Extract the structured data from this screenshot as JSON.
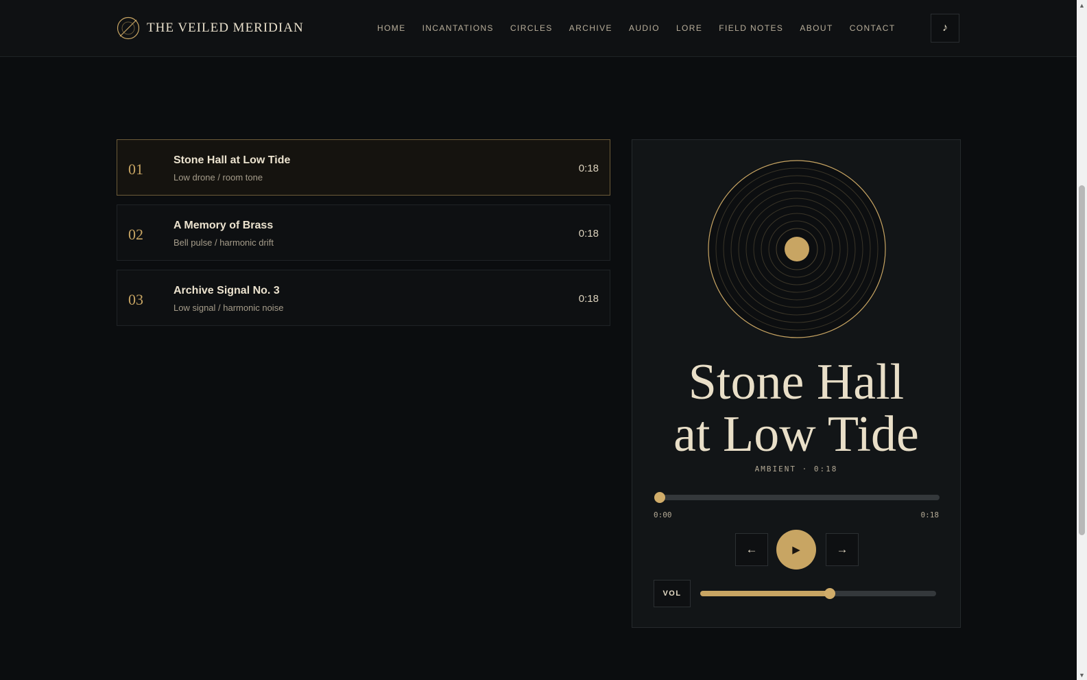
{
  "brand": {
    "name": "THE VEILED MERIDIAN"
  },
  "nav": [
    "HOME",
    "INCANTATIONS",
    "CIRCLES",
    "ARCHIVE",
    "AUDIO",
    "LORE",
    "FIELD NOTES",
    "ABOUT",
    "CONTACT"
  ],
  "header": {
    "music_icon": "♪"
  },
  "tracks": [
    {
      "num": "01",
      "title": "Stone Hall at Low Tide",
      "sub": "Low drone / room tone",
      "dur": "0:18"
    },
    {
      "num": "02",
      "title": "A Memory of Brass",
      "sub": "Bell pulse / harmonic drift",
      "dur": "0:18"
    },
    {
      "num": "03",
      "title": "Archive Signal No. 3",
      "sub": "Low signal / harmonic noise",
      "dur": "0:18"
    }
  ],
  "player": {
    "title_line1": "Stone Hall",
    "title_line2": "at Low Tide",
    "meta": "AMBIENT · 0:18",
    "time_current": "0:00",
    "time_total": "0:18",
    "progress_fraction": 0.0,
    "volume_fraction": 0.55,
    "prev_icon": "←",
    "next_icon": "→",
    "play_icon": "▶",
    "vol_label": "VOL"
  },
  "scrollbar": {
    "up": "▲",
    "down": "▼"
  },
  "colors": {
    "accent": "#c8a563",
    "background": "#0b0d0f",
    "text": "#e6dcc6"
  }
}
